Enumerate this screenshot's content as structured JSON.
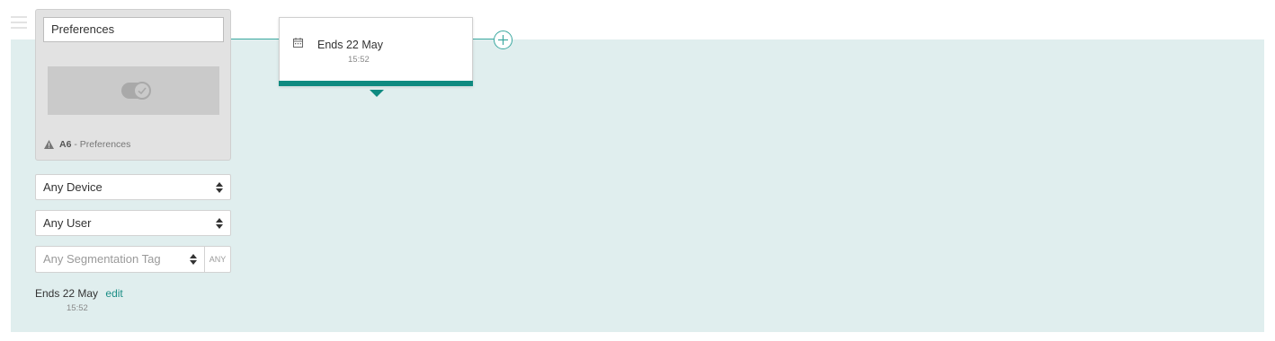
{
  "card": {
    "title": "Preferences",
    "code": "A6",
    "separator": " - ",
    "name": "Preferences"
  },
  "filters": {
    "device": "Any Device",
    "user": "Any User",
    "segmentation_placeholder": "Any Segmentation Tag",
    "any_label": "ANY"
  },
  "schedule": {
    "ends_label": "Ends",
    "date": "22 May",
    "time": "15:52",
    "edit_label": "edit"
  },
  "colors": {
    "accent": "#0f8a80",
    "canvas": "#e0eeee"
  }
}
